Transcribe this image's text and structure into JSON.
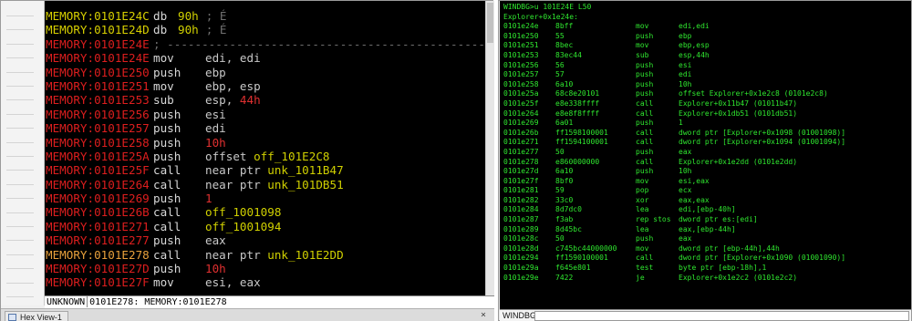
{
  "ida": {
    "lines": [
      {
        "addr": "MEMORY:0101E24C",
        "addr_color": "y",
        "mnemonic": "db",
        "kind": "db",
        "operand": "90h",
        "operand_color": "g",
        "comment": "; É"
      },
      {
        "addr": "MEMORY:0101E24D",
        "addr_color": "y",
        "mnemonic": "db",
        "kind": "db",
        "operand": "90h",
        "operand_color": "g",
        "comment": "; É"
      },
      {
        "addr": "MEMORY:0101E24E",
        "addr_color": "r",
        "kind": "sep",
        "text": "; ---------------------------------------------------------------"
      },
      {
        "addr": "MEMORY:0101E24E",
        "addr_color": "r",
        "mnemonic": "mov",
        "operand": "edi, edi"
      },
      {
        "addr": "MEMORY:0101E250",
        "addr_color": "r",
        "mnemonic": "push",
        "operand": "ebp"
      },
      {
        "addr": "MEMORY:0101E251",
        "addr_color": "r",
        "mnemonic": "mov",
        "operand": "ebp, esp"
      },
      {
        "addr": "MEMORY:0101E253",
        "addr_color": "r",
        "mnemonic": "sub",
        "operand": "esp, ",
        "operand2": "44h",
        "operand2_color": "r"
      },
      {
        "addr": "MEMORY:0101E256",
        "addr_color": "r",
        "mnemonic": "push",
        "operand": "esi"
      },
      {
        "addr": "MEMORY:0101E257",
        "addr_color": "r",
        "mnemonic": "push",
        "operand": "edi"
      },
      {
        "addr": "MEMORY:0101E258",
        "addr_color": "r",
        "mnemonic": "push",
        "operand": "10h",
        "operand_color": "r"
      },
      {
        "addr": "MEMORY:0101E25A",
        "addr_color": "r",
        "mnemonic": "push",
        "operand": "offset ",
        "operand2": "off_101E2C8",
        "operand2_color": "g"
      },
      {
        "addr": "MEMORY:0101E25F",
        "addr_color": "r",
        "mnemonic": "call",
        "operand": "near ptr ",
        "operand2": "unk_1011B47",
        "operand2_color": "g"
      },
      {
        "addr": "MEMORY:0101E264",
        "addr_color": "r",
        "mnemonic": "call",
        "operand": "near ptr ",
        "operand2": "unk_101DB51",
        "operand2_color": "g"
      },
      {
        "addr": "MEMORY:0101E269",
        "addr_color": "r",
        "mnemonic": "push",
        "operand": "1",
        "operand_color": "r"
      },
      {
        "addr": "MEMORY:0101E26B",
        "addr_color": "r",
        "mnemonic": "call",
        "operand": "off_1001098",
        "operand_color": "g"
      },
      {
        "addr": "MEMORY:0101E271",
        "addr_color": "r",
        "mnemonic": "call",
        "operand": "off_1001094",
        "operand_color": "g"
      },
      {
        "addr": "MEMORY:0101E277",
        "addr_color": "r",
        "mnemonic": "push",
        "operand": "eax"
      },
      {
        "addr": "MEMORY:0101E278",
        "addr_color": "o",
        "mnemonic": "call",
        "operand": "near ptr ",
        "operand2": "unk_101E2DD",
        "operand2_color": "g"
      },
      {
        "addr": "MEMORY:0101E27D",
        "addr_color": "r",
        "mnemonic": "push",
        "operand": "10h",
        "operand_color": "r"
      },
      {
        "addr": "MEMORY:0101E27F",
        "addr_color": "r",
        "mnemonic": "mov",
        "operand": "esi, eax"
      }
    ],
    "status_left": "UNKNOWN",
    "status_right": "0101E278: MEMORY:0101E278",
    "tab_label": "Hex View-1",
    "close_label": "×"
  },
  "windbg": {
    "command": "WINDBG>u 101E24E L50",
    "symbol": "Explorer+0x1e24e:",
    "lines": [
      {
        "addr": "0101e24e",
        "bytes": "8bff",
        "mnemonic": "mov",
        "operands": "edi,edi"
      },
      {
        "addr": "0101e250",
        "bytes": "55",
        "mnemonic": "push",
        "operands": "ebp"
      },
      {
        "addr": "0101e251",
        "bytes": "8bec",
        "mnemonic": "mov",
        "operands": "ebp,esp"
      },
      {
        "addr": "0101e253",
        "bytes": "83ec44",
        "mnemonic": "sub",
        "operands": "esp,44h"
      },
      {
        "addr": "0101e256",
        "bytes": "56",
        "mnemonic": "push",
        "operands": "esi"
      },
      {
        "addr": "0101e257",
        "bytes": "57",
        "mnemonic": "push",
        "operands": "edi"
      },
      {
        "addr": "0101e258",
        "bytes": "6a10",
        "mnemonic": "push",
        "operands": "10h"
      },
      {
        "addr": "0101e25a",
        "bytes": "68c8e20101",
        "mnemonic": "push",
        "operands": "offset Explorer+0x1e2c8 (0101e2c8)"
      },
      {
        "addr": "0101e25f",
        "bytes": "e8e338ffff",
        "mnemonic": "call",
        "operands": "Explorer+0x11b47 (01011b47)"
      },
      {
        "addr": "0101e264",
        "bytes": "e8e8f8ffff",
        "mnemonic": "call",
        "operands": "Explorer+0x1db51 (0101db51)"
      },
      {
        "addr": "0101e269",
        "bytes": "6a01",
        "mnemonic": "push",
        "operands": "1"
      },
      {
        "addr": "0101e26b",
        "bytes": "ff1598100001",
        "mnemonic": "call",
        "operands": "dword ptr [Explorer+0x1098 (01001098)]"
      },
      {
        "addr": "0101e271",
        "bytes": "ff1594100001",
        "mnemonic": "call",
        "operands": "dword ptr [Explorer+0x1094 (01001094)]"
      },
      {
        "addr": "0101e277",
        "bytes": "50",
        "mnemonic": "push",
        "operands": "eax"
      },
      {
        "addr": "0101e278",
        "bytes": "e860000000",
        "mnemonic": "call",
        "operands": "Explorer+0x1e2dd (0101e2dd)"
      },
      {
        "addr": "0101e27d",
        "bytes": "6a10",
        "mnemonic": "push",
        "operands": "10h"
      },
      {
        "addr": "0101e27f",
        "bytes": "8bf0",
        "mnemonic": "mov",
        "operands": "esi,eax"
      },
      {
        "addr": "0101e281",
        "bytes": "59",
        "mnemonic": "pop",
        "operands": "ecx"
      },
      {
        "addr": "0101e282",
        "bytes": "33c0",
        "mnemonic": "xor",
        "operands": "eax,eax"
      },
      {
        "addr": "0101e284",
        "bytes": "8d7dc0",
        "mnemonic": "lea",
        "operands": "edi,[ebp-40h]"
      },
      {
        "addr": "0101e287",
        "bytes": "f3ab",
        "mnemonic": "rep stos",
        "operands": "dword ptr es:[edi]"
      },
      {
        "addr": "0101e289",
        "bytes": "8d45bc",
        "mnemonic": "lea",
        "operands": "eax,[ebp-44h]"
      },
      {
        "addr": "0101e28c",
        "bytes": "50",
        "mnemonic": "push",
        "operands": "eax"
      },
      {
        "addr": "0101e28d",
        "bytes": "c745bc44000000",
        "mnemonic": "mov",
        "operands": "dword ptr [ebp-44h],44h"
      },
      {
        "addr": "0101e294",
        "bytes": "ff1590100001",
        "mnemonic": "call",
        "operands": "dword ptr [Explorer+0x1090 (01001090)]"
      },
      {
        "addr": "0101e29a",
        "bytes": "f645e801",
        "mnemonic": "test",
        "operands": "byte ptr [ebp-18h],1"
      },
      {
        "addr": "0101e29e",
        "bytes": "7422",
        "mnemonic": "je",
        "operands": "Explorer+0x1e2c2 (0101e2c2)"
      }
    ],
    "prompt": "WINDBG",
    "input_value": ""
  },
  "colors": {
    "ida_background": "#000000",
    "windbg_text": "#2fe72f"
  }
}
